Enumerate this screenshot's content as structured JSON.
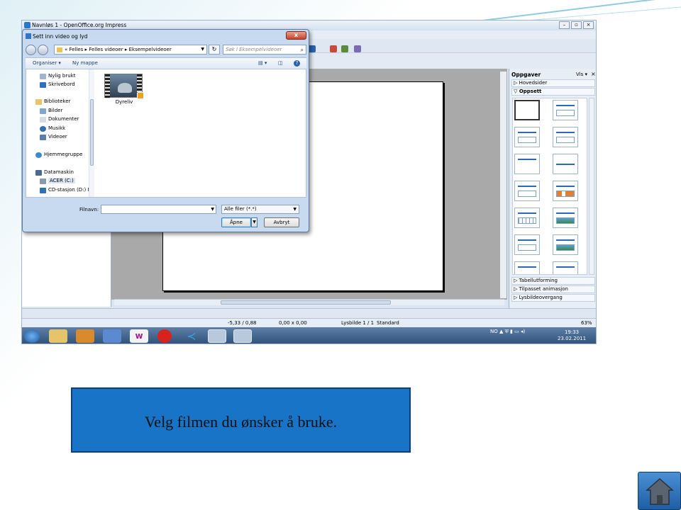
{
  "app_window": {
    "title": "Navnløs 1 - OpenOffice.org Impress"
  },
  "dialog": {
    "title": "Sett inn video og lyd",
    "close_glyph": "x",
    "breadcrumb": [
      "«",
      "Felles",
      "Felles videoer",
      "Eksempelvideoer"
    ],
    "search_placeholder": "Søk i Eksempelvideoer",
    "organize_label": "Organiser ▾",
    "new_folder_label": "Ny mappe",
    "nav_tree": [
      {
        "label": "Nylig brukt",
        "icon": "recent-icon"
      },
      {
        "label": "Skrivebord",
        "icon": "desktop-icon"
      },
      {
        "label": "Biblioteker",
        "icon": "libraries-icon"
      },
      {
        "label": "Bilder",
        "icon": "pictures-icon"
      },
      {
        "label": "Dokumenter",
        "icon": "documents-icon"
      },
      {
        "label": "Musikk",
        "icon": "music-icon"
      },
      {
        "label": "Videoer",
        "icon": "videos-icon"
      },
      {
        "label": "Hjemmegruppe",
        "icon": "homegroup-icon"
      },
      {
        "label": "Datamaskin",
        "icon": "computer-icon"
      },
      {
        "label": "ACER (C:)",
        "icon": "drive-icon"
      },
      {
        "label": "CD-stasjon (D:) M",
        "icon": "cd-drive-icon"
      }
    ],
    "files": [
      {
        "name": "Dyreliv",
        "icon": "video-file-icon"
      }
    ],
    "filename_label": "Filnavn:",
    "filename_value": "",
    "filetype_value": "Alle filer (*.*)",
    "open_label": "Åpne",
    "cancel_label": "Avbryt"
  },
  "taskpane": {
    "title": "Oppgaver",
    "view_label": "Vis",
    "sections": [
      "Hovedsider",
      "Oppsett",
      "Tabellutforming",
      "Tilpasset animasjon",
      "Lysbildeovergang"
    ]
  },
  "statusbar": {
    "position": "-5,33 / 0,88",
    "size": "0,00 x 0,00",
    "slide": "Lysbilde 1 / 1",
    "master": "Standard",
    "zoom": "63%"
  },
  "taskbar": {
    "lang": "NO",
    "time": "19:33",
    "date": "23.02.2011"
  },
  "caption": {
    "text": "Velg filmen du ønsker å bruke."
  },
  "colors": {
    "caption_bg": "#1874c6",
    "home_button": "#2a6fb8"
  }
}
